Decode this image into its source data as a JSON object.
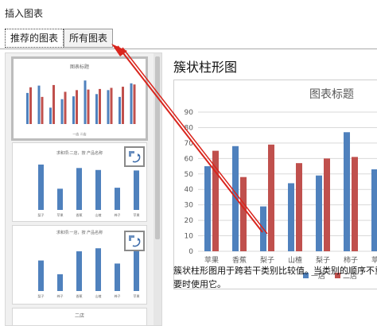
{
  "dialog": {
    "title": "插入图表"
  },
  "tabs": [
    {
      "label": "推荐的图表",
      "active": true
    },
    {
      "label": "所有图表",
      "active": false
    }
  ],
  "thumbnails": [
    {
      "title": "图表标题",
      "legend": "一店 二店"
    },
    {
      "title": "求和项:二店，按 产品名称",
      "categories": [
        "梨子",
        "苹果",
        "香蕉",
        "山楂",
        "柿子",
        "苹果"
      ]
    },
    {
      "title": "求和项:一店，按 产品名称",
      "categories": [
        "梨子",
        "柿子",
        "香蕉",
        "山楂",
        "柿子",
        "苹果"
      ]
    },
    {
      "title": "二店"
    }
  ],
  "preview": {
    "chart_type_name": "簇状柱形图",
    "description": "簇状柱形图用于跨若干类别比较值。当类别的顺序不重要时使用它。"
  },
  "colors": {
    "series1": "#4f81bd",
    "series2": "#c0504d",
    "selection": "#bdbdbd",
    "annotation": "#d9251d"
  },
  "icons": {
    "badge": "chart-switch-icon"
  },
  "chart_data": {
    "type": "bar",
    "title": "图表标题",
    "categories": [
      "苹果",
      "香蕉",
      "梨子",
      "山楂",
      "梨子",
      "柿子",
      "苹果"
    ],
    "series": [
      {
        "name": "一店",
        "values": [
          55,
          68,
          29,
          44,
          49,
          77,
          53
        ]
      },
      {
        "name": "二店",
        "values": [
          65,
          48,
          69,
          57,
          60,
          61,
          62
        ]
      }
    ],
    "ylim": [
      0,
      90
    ],
    "yticks": [
      0,
      10,
      20,
      30,
      40,
      50,
      60,
      70,
      80,
      90
    ],
    "grid": true,
    "legend_position": "bottom"
  }
}
